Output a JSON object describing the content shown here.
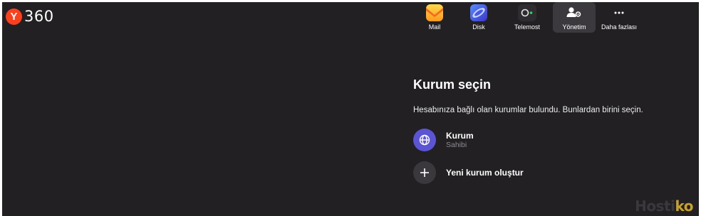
{
  "brand": {
    "badge": "Y",
    "name": "360",
    "badge_color": "#fc3f1d"
  },
  "nav": {
    "mail": {
      "label": "Mail",
      "icon": "mail-icon"
    },
    "disk": {
      "label": "Disk",
      "icon": "disk-icon"
    },
    "telemost": {
      "label": "Telemost",
      "icon": "telemost-icon"
    },
    "yonetim": {
      "label": "Yönetim",
      "icon": "admin-icon",
      "active": true
    },
    "more": {
      "label": "Daha fazlası",
      "icon": "more-icon"
    }
  },
  "main": {
    "title": "Kurum seçin",
    "description": "Hesabınıza bağlı olan kurumlar bulundu. Bunlardan birini seçin.",
    "organizations": [
      {
        "name": "Kurum",
        "role": "Sahibi",
        "icon": "globe-icon"
      }
    ],
    "create_label": "Yeni kurum oluştur"
  },
  "watermark": {
    "text_main": "Hosti",
    "text_accent": "ko"
  },
  "colors": {
    "background": "#222023",
    "accent": "#5b55d6",
    "active_tab": "#3b393d"
  }
}
